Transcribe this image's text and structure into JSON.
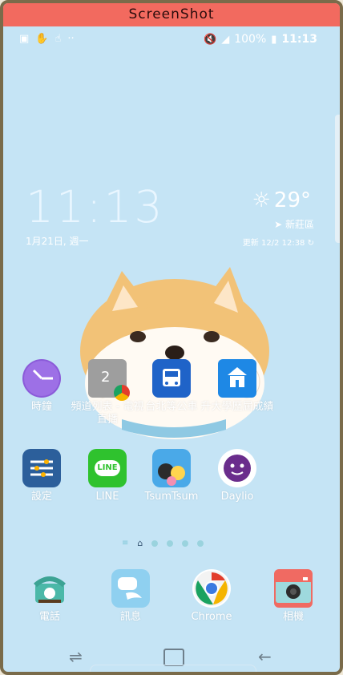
{
  "window": {
    "title": "ScreenShot"
  },
  "status_bar": {
    "battery": "100%",
    "time": "11:13",
    "left_icons": [
      "tray-icon",
      "finger-icon",
      "hand-icon",
      "more-icon"
    ],
    "right_icons": [
      "mute-icon",
      "signal-icon",
      "battery-icon"
    ]
  },
  "widget": {
    "time": "11:13",
    "date": "1月21日, 週一",
    "temperature": "29°",
    "location": "新莊區",
    "updated": "更新 12/2 12:38"
  },
  "apps_row1": [
    {
      "label": "時鐘",
      "icon": "clock-icon"
    },
    {
      "label": "頻道列表 - 電視直播",
      "icon": "tv-channel-icon",
      "badge": "2"
    },
    {
      "label": "台北等公車",
      "icon": "bus-icon"
    },
    {
      "label": "升大學歷屆成績",
      "icon": "school-icon"
    }
  ],
  "apps_row2": [
    {
      "label": "設定",
      "icon": "settings-icon"
    },
    {
      "label": "LINE",
      "icon": "line-icon",
      "badge": "LINE"
    },
    {
      "label": "TsumTsum",
      "icon": "tsumtsum-icon"
    },
    {
      "label": "Daylio",
      "icon": "daylio-icon"
    }
  ],
  "dock": [
    {
      "label": "電話",
      "icon": "phone-icon"
    },
    {
      "label": "訊息",
      "icon": "messages-icon"
    },
    {
      "label": "Chrome",
      "icon": "chrome-icon"
    },
    {
      "label": "相機",
      "icon": "camera-icon"
    }
  ],
  "colors": {
    "background": "#c5e4f5",
    "titlebar": "#f26a5f"
  }
}
